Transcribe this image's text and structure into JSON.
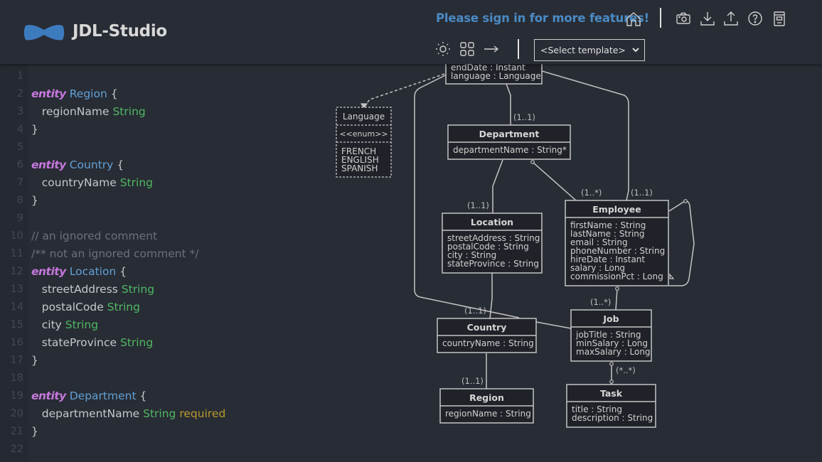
{
  "header": {
    "brand": "JDL-Studio",
    "signin_text": "Please sign in for more features!",
    "icons": [
      "home-icon",
      "camera-icon",
      "download-icon",
      "upload-icon",
      "help-icon",
      "storage-icon",
      "sun-icon",
      "grid-icon",
      "arrow-right-icon"
    ],
    "template_select": {
      "selected": "<Select template>"
    },
    "colors": {
      "accent": "#4a8ac4",
      "background": "#282c34"
    }
  },
  "editor": {
    "lines": [
      {
        "n": "1",
        "tokens": []
      },
      {
        "n": "2",
        "tokens": [
          {
            "c": "kw",
            "t": "entity"
          },
          {
            "c": "",
            "t": " "
          },
          {
            "c": "ent",
            "t": "Region"
          },
          {
            "c": "",
            "t": " {"
          }
        ]
      },
      {
        "n": "3",
        "tokens": [
          {
            "c": "",
            "t": "   regionName "
          },
          {
            "c": "ty",
            "t": "String"
          }
        ]
      },
      {
        "n": "4",
        "tokens": [
          {
            "c": "",
            "t": "}"
          }
        ]
      },
      {
        "n": "5",
        "tokens": []
      },
      {
        "n": "6",
        "tokens": [
          {
            "c": "kw",
            "t": "entity"
          },
          {
            "c": "",
            "t": " "
          },
          {
            "c": "ent",
            "t": "Country"
          },
          {
            "c": "",
            "t": " {"
          }
        ]
      },
      {
        "n": "7",
        "tokens": [
          {
            "c": "",
            "t": "   countryName "
          },
          {
            "c": "ty",
            "t": "String"
          }
        ]
      },
      {
        "n": "8",
        "tokens": [
          {
            "c": "",
            "t": "}"
          }
        ]
      },
      {
        "n": "9",
        "tokens": []
      },
      {
        "n": "10",
        "tokens": [
          {
            "c": "cm",
            "t": "// an ignored comment"
          }
        ]
      },
      {
        "n": "11",
        "tokens": [
          {
            "c": "cm",
            "t": "/** not an ignored comment */"
          }
        ]
      },
      {
        "n": "12",
        "tokens": [
          {
            "c": "kw",
            "t": "entity"
          },
          {
            "c": "",
            "t": " "
          },
          {
            "c": "ent",
            "t": "Location"
          },
          {
            "c": "",
            "t": " {"
          }
        ]
      },
      {
        "n": "13",
        "tokens": [
          {
            "c": "",
            "t": "   streetAddress "
          },
          {
            "c": "ty",
            "t": "String"
          }
        ]
      },
      {
        "n": "14",
        "tokens": [
          {
            "c": "",
            "t": "   postalCode "
          },
          {
            "c": "ty",
            "t": "String"
          }
        ]
      },
      {
        "n": "15",
        "tokens": [
          {
            "c": "",
            "t": "   city "
          },
          {
            "c": "ty",
            "t": "String"
          }
        ]
      },
      {
        "n": "16",
        "tokens": [
          {
            "c": "",
            "t": "   stateProvince "
          },
          {
            "c": "ty",
            "t": "String"
          }
        ]
      },
      {
        "n": "17",
        "tokens": [
          {
            "c": "",
            "t": "}"
          }
        ]
      },
      {
        "n": "18",
        "tokens": []
      },
      {
        "n": "19",
        "tokens": [
          {
            "c": "kw",
            "t": "entity"
          },
          {
            "c": "",
            "t": " "
          },
          {
            "c": "ent",
            "t": "Department"
          },
          {
            "c": "",
            "t": " {"
          }
        ]
      },
      {
        "n": "20",
        "tokens": [
          {
            "c": "",
            "t": "   departmentName "
          },
          {
            "c": "ty",
            "t": "String"
          },
          {
            "c": "",
            "t": " "
          },
          {
            "c": "val",
            "t": "required"
          }
        ]
      },
      {
        "n": "21",
        "tokens": [
          {
            "c": "",
            "t": "}"
          }
        ]
      },
      {
        "n": "22",
        "tokens": []
      }
    ]
  },
  "diagram": {
    "top_partial_entity": {
      "fields": [
        "endDate : Instant",
        "language : Language"
      ]
    },
    "enum": {
      "name": "Language",
      "stereotype": "<<enum>>",
      "values": [
        "FRENCH",
        "ENGLISH",
        "SPANISH"
      ]
    },
    "entities": [
      {
        "id": "department",
        "name": "Department",
        "fields": [
          "departmentName : String*"
        ]
      },
      {
        "id": "location",
        "name": "Location",
        "fields": [
          "streetAddress : String",
          "postalCode : String",
          "city : String",
          "stateProvince : String"
        ]
      },
      {
        "id": "employee",
        "name": "Employee",
        "fields": [
          "firstName : String",
          "lastName : String",
          "email : String",
          "phoneNumber : String",
          "hireDate : Instant",
          "salary : Long",
          "commissionPct : Long"
        ]
      },
      {
        "id": "country",
        "name": "Country",
        "fields": [
          "countryName : String"
        ]
      },
      {
        "id": "job",
        "name": "Job",
        "fields": [
          "jobTitle : String",
          "minSalary : Long",
          "maxSalary : Long"
        ]
      },
      {
        "id": "region",
        "name": "Region",
        "fields": [
          "regionName : String"
        ]
      },
      {
        "id": "task",
        "name": "Task",
        "fields": [
          "title : String",
          "description : String"
        ]
      }
    ],
    "multiplicities": {
      "dept_top": "(1..1)",
      "location_top": "(1..1)",
      "employee_left": "(1..*)",
      "employee_right": "(1..1)",
      "country_top": "(1..1)",
      "job_top": "(1..*)",
      "region_top": "(1..1)",
      "task_rel": "(*..*)"
    }
  }
}
